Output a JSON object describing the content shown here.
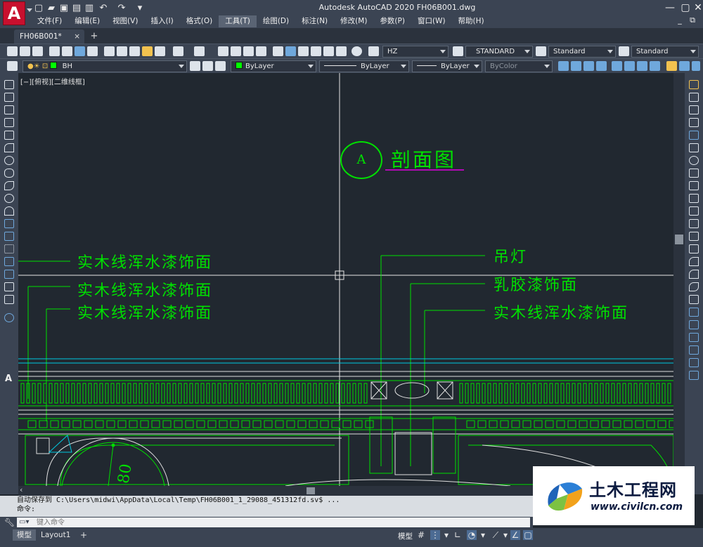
{
  "app": {
    "logo_letter": "A",
    "window_title": "Autodesk AutoCAD 2020    FH06B001.dwg"
  },
  "menu": [
    "文件(F)",
    "编辑(E)",
    "视图(V)",
    "插入(I)",
    "格式(O)",
    "工具(T)",
    "绘图(D)",
    "标注(N)",
    "修改(M)",
    "参数(P)",
    "窗口(W)",
    "帮助(H)"
  ],
  "active_menu": "工具(T)",
  "tabs": {
    "document": "FH06B001*",
    "close_glyph": "×",
    "add_glyph": "+"
  },
  "toolbar": {
    "text_style": "HZ",
    "dim_style": "STANDARD",
    "table_style": "Standard",
    "multileader_style": "Standard",
    "layer": "BH",
    "color": "ByLayer",
    "linetype": "ByLayer",
    "lineweight": "ByLayer",
    "plot_style": "ByColor",
    "layer_color": "#00ff00"
  },
  "viewport": {
    "label": "[−][俯视][二维线框]"
  },
  "drawing": {
    "section_marker": "A",
    "section_title": "剖面图",
    "labels_left": [
      "实木线浑水漆饰面",
      "实木线浑水漆饰面",
      "实木线浑水漆饰面"
    ],
    "labels_right": [
      "吊灯",
      "乳胶漆饰面",
      "实木线浑水漆饰面"
    ],
    "dimension_text": "80",
    "colors": {
      "annotation": "#00e000",
      "lines": "#e0e0e0",
      "cyan": "#00c8e0",
      "magenta": "#e000e0"
    }
  },
  "command": {
    "history_1": "自动保存到 C:\\Users\\midwi\\AppData\\Local\\Temp\\FH06B001_1_29088_451312fd.sv$ ...",
    "history_2": "命令:",
    "input_placeholder": "键入命令"
  },
  "status": {
    "tab_model": "模型",
    "tab_layout1": "Layout1",
    "tab_add": "+",
    "space": "模型"
  },
  "watermark": {
    "title": "土木工程网",
    "url": "www.civilcn.com"
  }
}
